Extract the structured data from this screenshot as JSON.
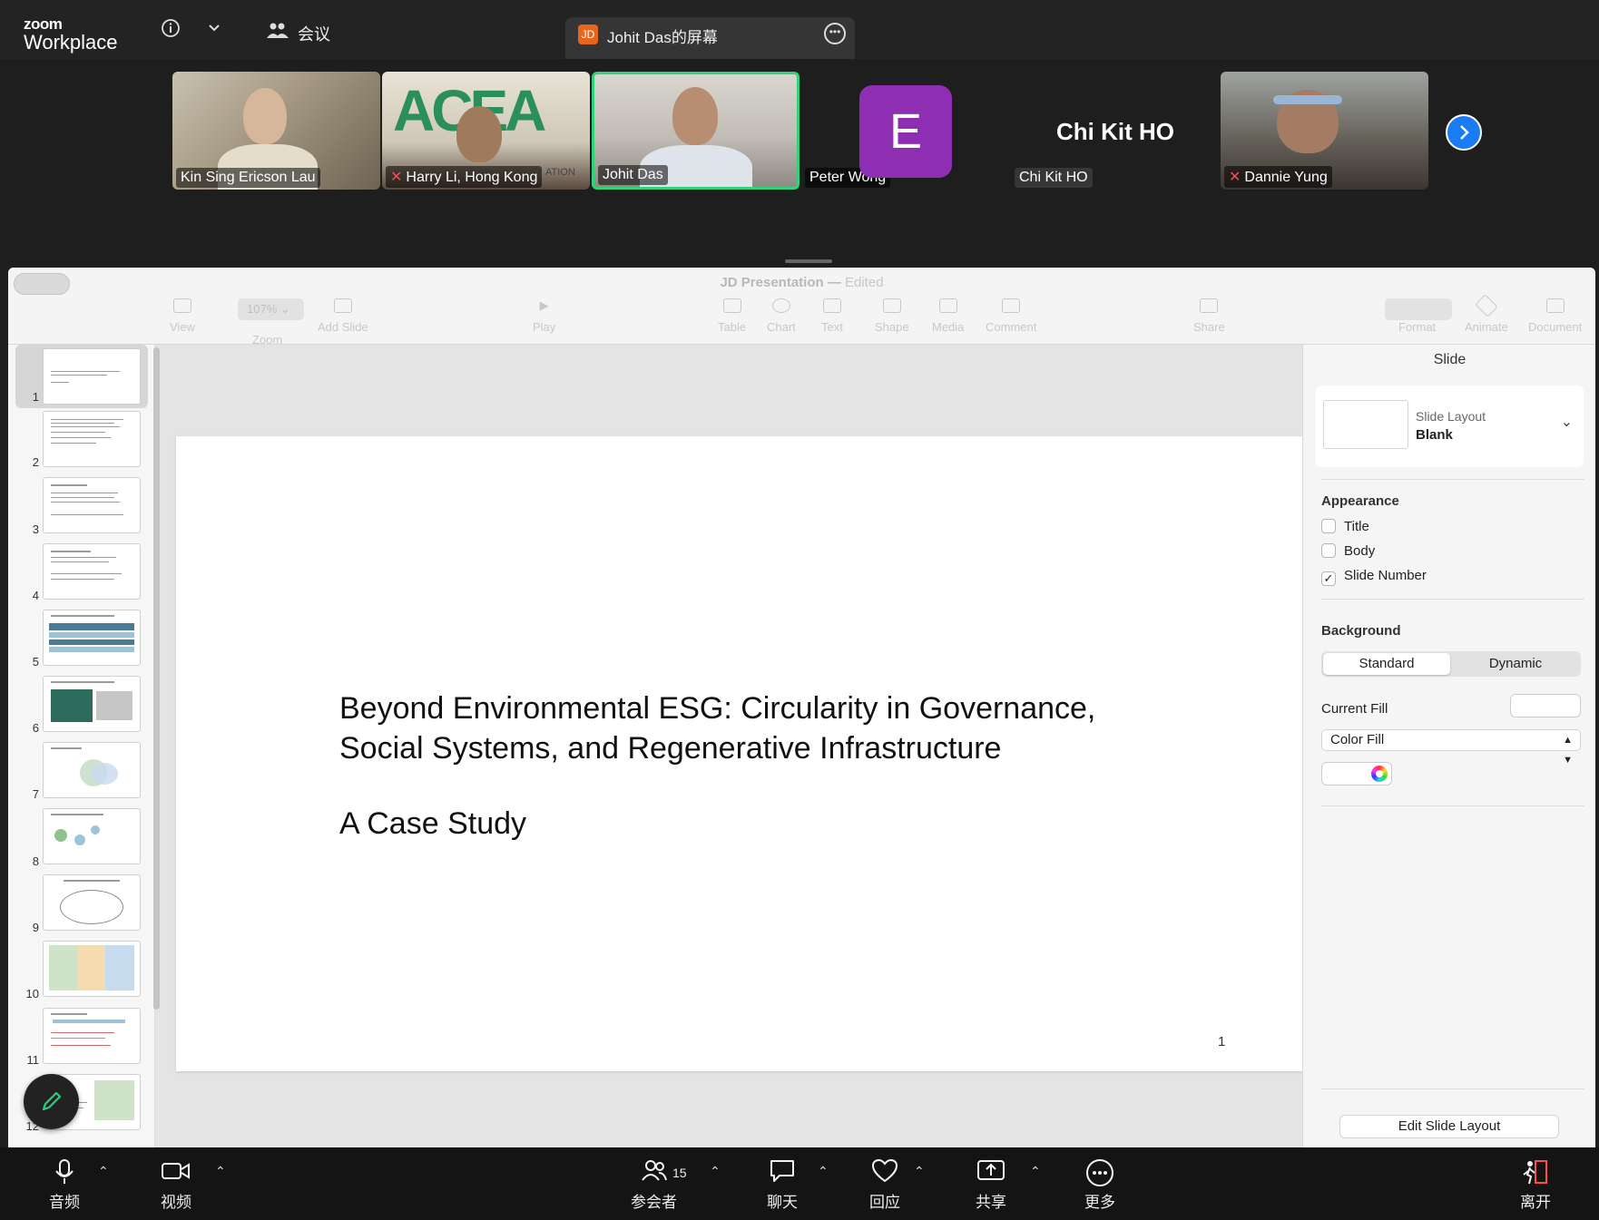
{
  "zoom": {
    "logo_top": "zoom",
    "logo_bottom": "Workplace",
    "info_icon": "info-icon",
    "meeting_label": "会议",
    "share_tab": {
      "badge": "JD",
      "title": "Johit Das的屏幕"
    }
  },
  "participants": [
    {
      "name": "Kin Sing Ericson Lau",
      "muted": false
    },
    {
      "name": "Harry Li, Hong Kong",
      "muted": true,
      "logo_text": "ACEA",
      "caption_text": "ATION"
    },
    {
      "name": "Johit Das",
      "muted": false,
      "active": true
    },
    {
      "name": "Peter Wong",
      "muted": false,
      "avatar_letter": "E"
    },
    {
      "name": "Chi Kit HO",
      "muted": false,
      "display": "Chi Kit HO"
    },
    {
      "name": "Dannie Yung",
      "muted": true
    }
  ],
  "keynote": {
    "doc_title": "JD Presentation",
    "doc_status": "Edited",
    "zoom_level": "107%",
    "toolbar": [
      {
        "label": "View",
        "icon": "sidebar-icon"
      },
      {
        "label": "Zoom",
        "icon": "zoom-icon"
      },
      {
        "label": "Add Slide",
        "icon": "add-slide-icon"
      },
      {
        "label": "Play",
        "icon": "play-icon"
      },
      {
        "label": "Table",
        "icon": "table-icon"
      },
      {
        "label": "Chart",
        "icon": "chart-icon"
      },
      {
        "label": "Text",
        "icon": "text-icon"
      },
      {
        "label": "Shape",
        "icon": "shape-icon"
      },
      {
        "label": "Media",
        "icon": "media-icon"
      },
      {
        "label": "Comment",
        "icon": "comment-icon"
      },
      {
        "label": "Share",
        "icon": "share-icon"
      },
      {
        "label": "Format",
        "icon": "format-icon"
      },
      {
        "label": "Animate",
        "icon": "animate-icon"
      },
      {
        "label": "Document",
        "icon": "document-icon"
      }
    ],
    "slide_numbers": [
      "1",
      "2",
      "3",
      "4",
      "5",
      "6",
      "7",
      "8",
      "9",
      "10",
      "11",
      "12"
    ],
    "slide": {
      "title_line1": "Beyond Environmental ESG: Circularity in Governance,",
      "title_line2": "Social Systems, and Regenerative Infrastructure",
      "subtitle": "A Case Study",
      "number": "1"
    },
    "inspector": {
      "header": "Slide",
      "layout_label": "Slide Layout",
      "layout_value": "Blank",
      "appearance_heading": "Appearance",
      "appearance_items": [
        {
          "label": "Title",
          "checked": false
        },
        {
          "label": "Body",
          "checked": false
        },
        {
          "label": "Slide Number",
          "checked": true
        }
      ],
      "background_heading": "Background",
      "segments": [
        "Standard",
        "Dynamic"
      ],
      "current_fill_label": "Current Fill",
      "fill_type": "Color Fill",
      "edit_layout_button": "Edit Slide Layout"
    }
  },
  "bottom_bar": {
    "audio": "音频",
    "video": "视频",
    "participants": "参会者",
    "participant_count": "15",
    "chat": "聊天",
    "reactions": "回应",
    "share": "共享",
    "more": "更多",
    "leave": "离开"
  },
  "colors": {
    "active_speaker": "#2fd37a",
    "avatar_purple": "#8e2fb3",
    "next_button": "#1a7cf5",
    "share_badge": "#e8661b",
    "mute": "#ff4d4d"
  }
}
